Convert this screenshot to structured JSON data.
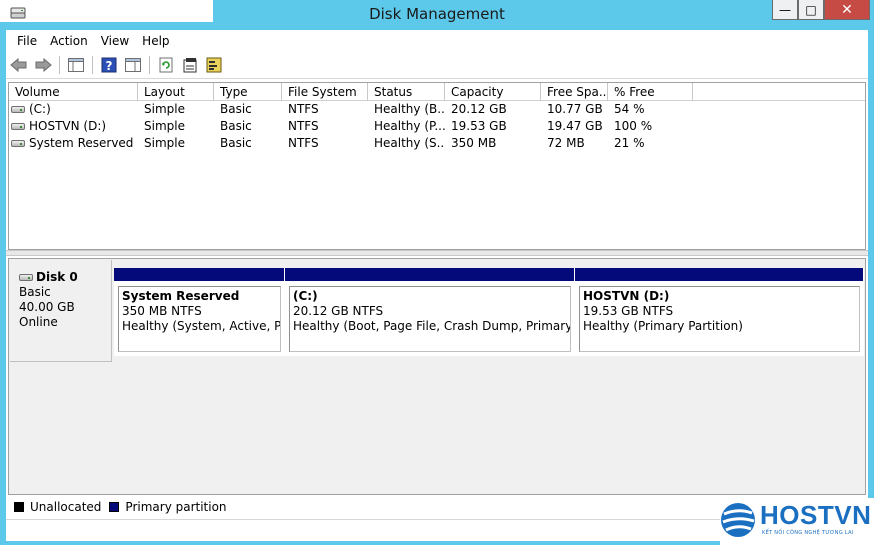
{
  "window": {
    "title": "Disk Management",
    "buttons": {
      "minimize": "—",
      "maximize": "□",
      "close": "✕"
    }
  },
  "menu": [
    "File",
    "Action",
    "View",
    "Help"
  ],
  "toolbar": {
    "icons": [
      "back-icon",
      "forward-icon",
      "console-tree-icon",
      "help-icon",
      "show-pane-icon",
      "refresh-icon",
      "properties-icon",
      "export-list-icon"
    ]
  },
  "volume_list": {
    "columns": [
      "Volume",
      "Layout",
      "Type",
      "File System",
      "Status",
      "Capacity",
      "Free Spa...",
      "% Free"
    ],
    "rows": [
      [
        "(C:)",
        "Simple",
        "Basic",
        "NTFS",
        "Healthy (B...",
        "20.12 GB",
        "10.77 GB",
        "54 %"
      ],
      [
        "HOSTVN (D:)",
        "Simple",
        "Basic",
        "NTFS",
        "Healthy (P...",
        "19.53 GB",
        "19.47 GB",
        "100 %"
      ],
      [
        "System Reserved",
        "Simple",
        "Basic",
        "NTFS",
        "Healthy (S...",
        "350 MB",
        "72 MB",
        "21 %"
      ]
    ]
  },
  "disk": {
    "name": "Disk 0",
    "type": "Basic",
    "size": "40.00 GB",
    "status": "Online"
  },
  "partitions": [
    {
      "name": "System Reserved",
      "size": "350 MB NTFS",
      "status": "Healthy (System, Active, Prim"
    },
    {
      "name": "(C:)",
      "size": "20.12 GB NTFS",
      "status": "Healthy (Boot, Page File, Crash Dump, Primary Partit"
    },
    {
      "name": "HOSTVN  (D:)",
      "size": "19.53 GB NTFS",
      "status": "Healthy (Primary Partition)"
    }
  ],
  "legend": [
    {
      "label": "Unallocated",
      "color": "#000000"
    },
    {
      "label": "Primary partition",
      "color": "#050a7a"
    }
  ],
  "watermark": {
    "brand": "HOSTVN",
    "tagline": "KẾT NỐI CÔNG NGHỆ TƯƠNG LAI"
  },
  "colors": {
    "frame": "#5cc8ea",
    "partition_band": "#050a7a",
    "close_button": "#c74b45",
    "brand": "#1b6fc1"
  }
}
